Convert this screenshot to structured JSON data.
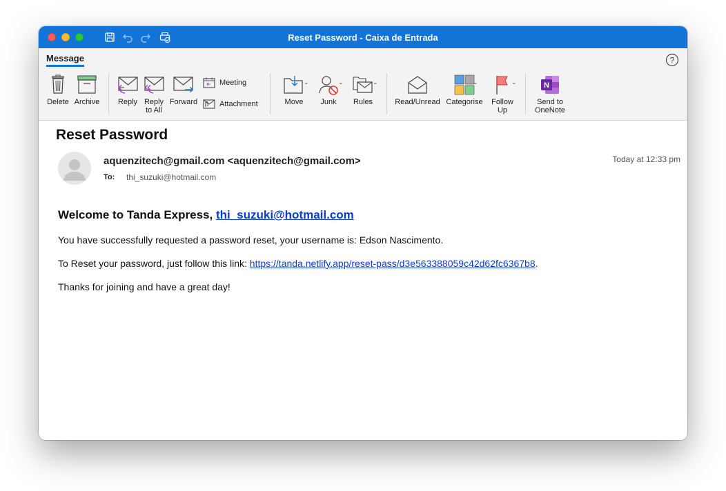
{
  "window": {
    "title": "Reset Password - Caixa de Entrada"
  },
  "ribbon": {
    "tab": "Message",
    "buttons": {
      "delete": "Delete",
      "archive": "Archive",
      "reply": "Reply",
      "reply_all_1": "Reply",
      "reply_all_2": "to All",
      "forward": "Forward",
      "meeting": "Meeting",
      "attachment": "Attachment",
      "move": "Move",
      "junk": "Junk",
      "rules": "Rules",
      "read_unread": "Read/Unread",
      "categorise": "Categorise",
      "follow_up_1": "Follow",
      "follow_up_2": "Up",
      "onenote_1": "Send to",
      "onenote_2": "OneNote"
    }
  },
  "message": {
    "subject": "Reset Password",
    "sender": "aquenzitech@gmail.com <aquenzitech@gmail.com>",
    "to_label": "To:",
    "to": "thi_suzuki@hotmail.com",
    "time": "Today at 12:33 pm",
    "welcome_prefix": "Welcome to Tanda Express, ",
    "welcome_email": "thi_suzuki@hotmail.com",
    "line1": "You have successfully requested a password reset, your username is: Edson Nascimento.",
    "line2_prefix": "To Reset your password, just follow this link: ",
    "line2_link": "https://tanda.netlify.app/reset-pass/d3e563388059c42d62fc6367b8",
    "line2_suffix": ".",
    "line3": "Thanks for joining and have a great day!"
  },
  "colors": {
    "titlebar": "#1274d6",
    "link": "#0b3bd6"
  },
  "icons": [
    "save-icon",
    "undo-icon",
    "redo-icon",
    "print-icon",
    "help-icon",
    "delete-icon",
    "archive-icon",
    "reply-icon",
    "reply-all-icon",
    "forward-icon",
    "meeting-icon",
    "attachment-icon",
    "move-icon",
    "junk-icon",
    "rules-icon",
    "read-unread-icon",
    "categorise-icon",
    "follow-up-icon",
    "onenote-icon",
    "avatar-icon"
  ]
}
